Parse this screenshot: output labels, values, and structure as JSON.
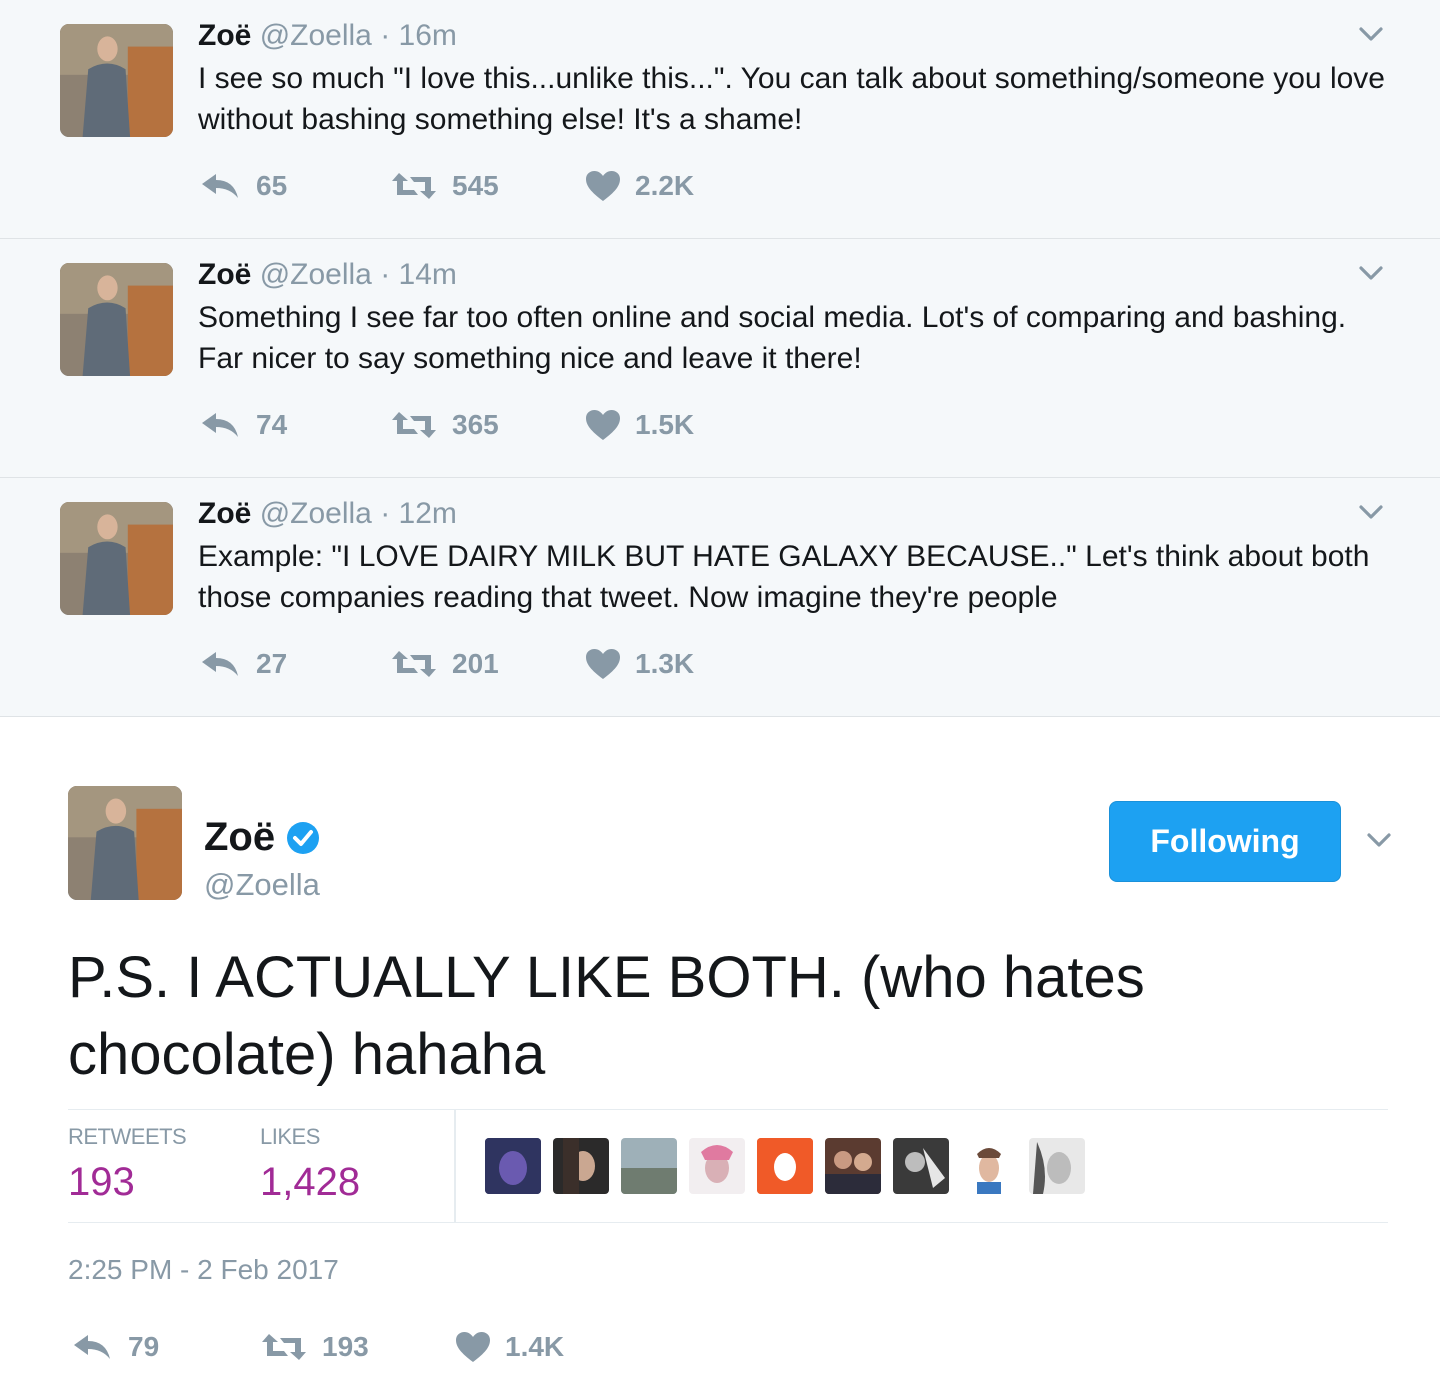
{
  "colors": {
    "icon_gray": "#8899a6",
    "follow_blue": "#1da1f2",
    "stat_purple": "#a12b96",
    "verified_blue": "#1da1f2"
  },
  "tweets": [
    {
      "name": "Zoë",
      "handle": "@Zoella",
      "time": "16m",
      "text": "I see so much \"I love this...unlike this...\". You can talk about something/someone you love without bashing something else! It's a shame!",
      "replies": "65",
      "retweets": "545",
      "likes": "2.2K"
    },
    {
      "name": "Zoë",
      "handle": "@Zoella",
      "time": "14m",
      "text": "Something I see far too often online and social media. Lot's of comparing and bashing. Far nicer to say something nice and leave it there!",
      "replies": "74",
      "retweets": "365",
      "likes": "1.5K"
    },
    {
      "name": "Zoë",
      "handle": "@Zoella",
      "time": "12m",
      "text": "Example: \"I LOVE DAIRY MILK BUT HATE GALAXY BECAUSE..\" Let's think about both those companies reading that tweet. Now imagine they're people",
      "replies": "27",
      "retweets": "201",
      "likes": "1.3K"
    }
  ],
  "separator": " · ",
  "focused": {
    "name": "Zoë",
    "handle": "@Zoella",
    "follow_label": "Following",
    "text": "P.S. I ACTUALLY LIKE BOTH. (who hates chocolate) hahaha",
    "retweets_label": "RETWEETS",
    "retweets_value": "193",
    "likes_label": "LIKES",
    "likes_value": "1,428",
    "timestamp": "2:25 PM - 2 Feb 2017",
    "replies": "79",
    "retweets": "193",
    "likes": "1.4K",
    "liker_count_shown": 9
  }
}
